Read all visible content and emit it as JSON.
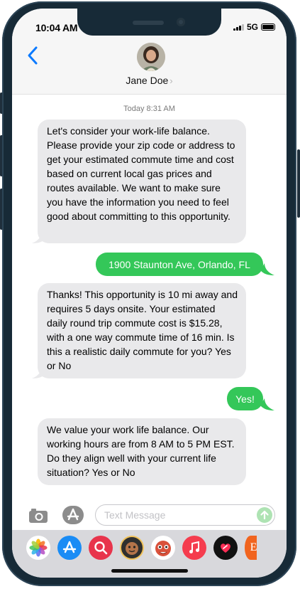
{
  "status_bar": {
    "time": "10:04 AM",
    "network": "5G"
  },
  "header": {
    "back_icon": "chevron-left-icon",
    "contact_name": "Jane Doe",
    "chevron": "›"
  },
  "conversation": {
    "timestamp_day": "Today",
    "timestamp_time": "8:31 AM",
    "messages": [
      {
        "direction": "incoming",
        "text": "Let's consider your work-life balance. Please provide your zip code or address to get your estimated commute time and cost based on current local gas prices and routes available. We want to make sure you have the information you need to feel good about committing to this opportunity."
      },
      {
        "direction": "outgoing",
        "text": "1900 Staunton Ave, Orlando, FL"
      },
      {
        "direction": "incoming",
        "text": "Thanks! This opportunity is 10 mi away and requires 5 days onsite. Your estimated daily round trip commute cost is $15.28, with a one way commute time of 16 min. Is this a realistic daily commute for you? Yes or No"
      },
      {
        "direction": "outgoing",
        "text": "Yes!"
      },
      {
        "direction": "incoming",
        "text": "We value your work life balance. Our working hours are from 8 AM to 5 PM EST. Do they align well with your current life situation? Yes or No"
      }
    ]
  },
  "composer": {
    "placeholder": "Text Message",
    "camera_icon": "camera-icon",
    "apps_icon": "app-store-icon",
    "send_icon": "send-arrow-icon"
  },
  "app_drawer": {
    "apps": [
      {
        "name": "photos-app-icon"
      },
      {
        "name": "app-store-app-icon"
      },
      {
        "name": "image-search-app-icon"
      },
      {
        "name": "memoji-app-icon"
      },
      {
        "name": "animoji-app-icon"
      },
      {
        "name": "music-app-icon"
      },
      {
        "name": "digital-touch-app-icon"
      },
      {
        "name": "etsy-app-icon",
        "label": "E"
      }
    ]
  },
  "colors": {
    "accent": "#0a7aff",
    "outgoing_bubble": "#34c759",
    "incoming_bubble": "#e9e9eb",
    "frame": "#172a37"
  }
}
